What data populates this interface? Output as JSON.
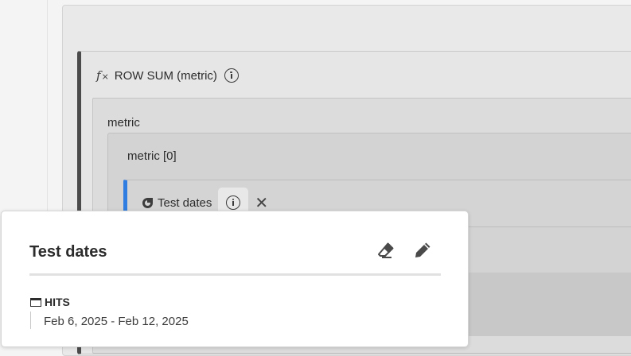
{
  "function_block": {
    "icon": "fx-icon",
    "title": "ROW SUM (metric)",
    "info_icon": "info-icon"
  },
  "metric_group": {
    "label": "metric",
    "item": {
      "label": "metric [0]",
      "segment": {
        "name": "Test dates",
        "icon": "segment-icon",
        "info_icon": "info-icon",
        "remove_icon": "close-icon",
        "accent_color": "#2f7de0"
      }
    }
  },
  "popover": {
    "title": "Test dates",
    "actions": [
      {
        "icon": "eraser-icon"
      },
      {
        "icon": "pencil-icon"
      }
    ],
    "container_icon": "container-icon",
    "container_label": "HITS",
    "rule": "Feb 6, 2025 - Feb 12, 2025"
  }
}
